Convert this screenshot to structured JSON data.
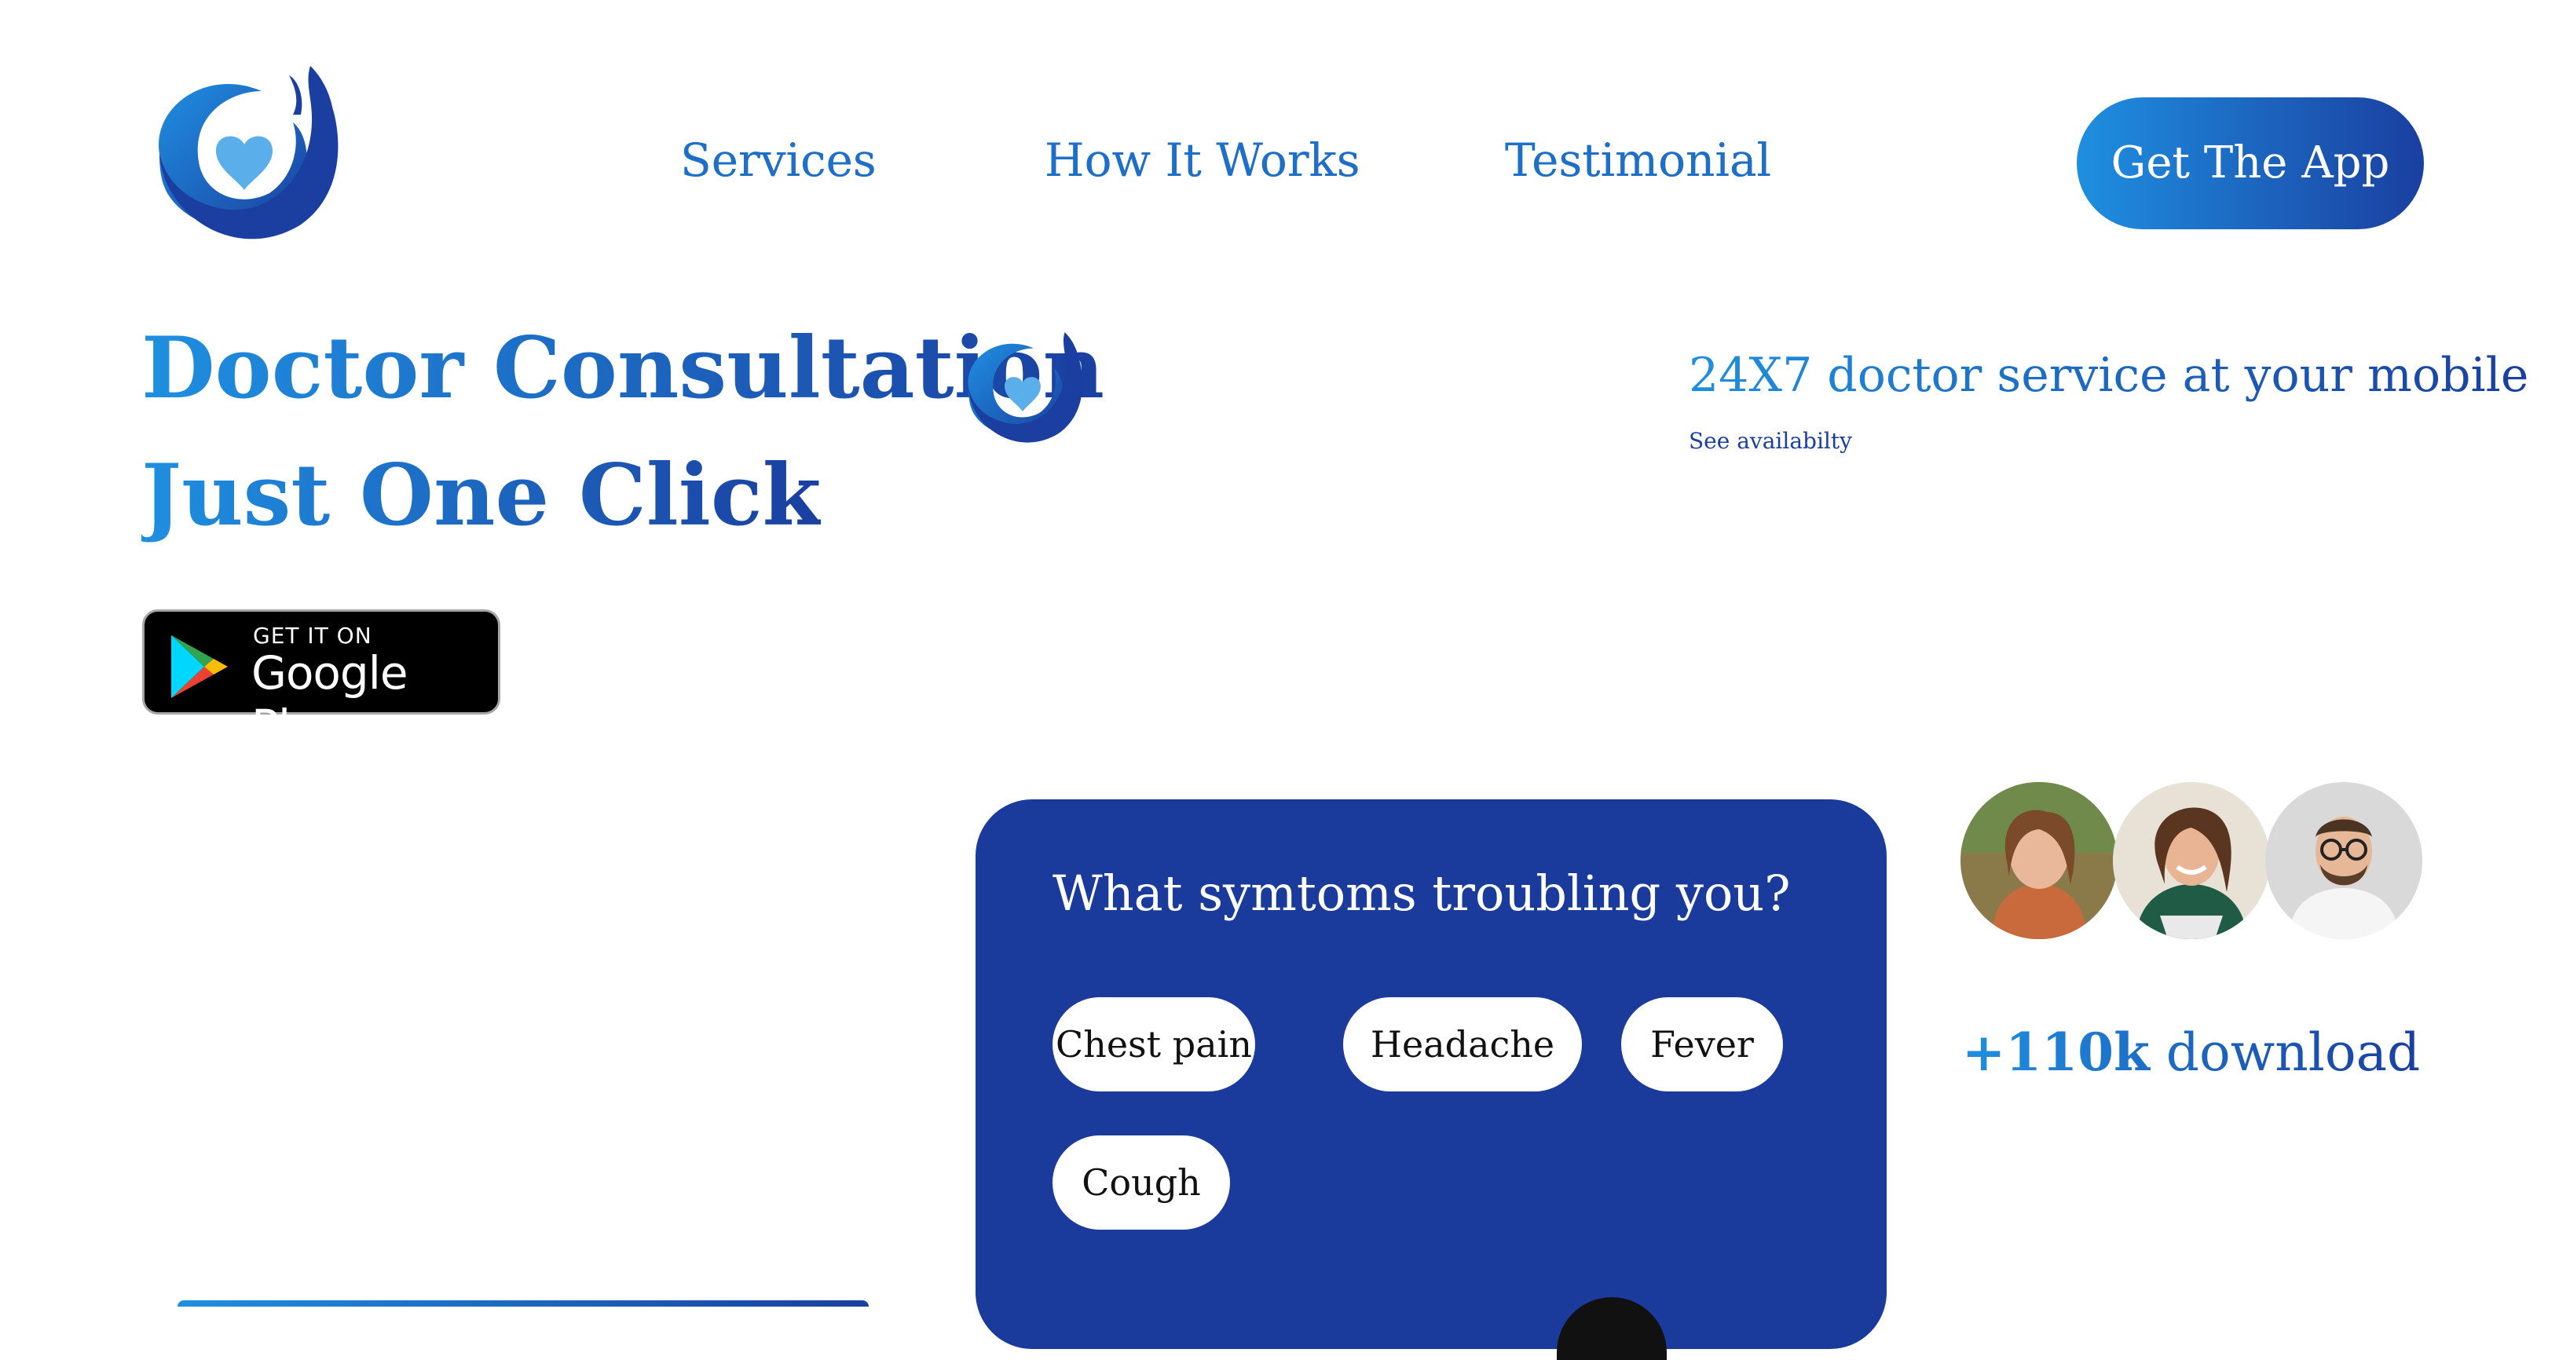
{
  "nav": {
    "items": [
      {
        "label": "Services"
      },
      {
        "label": "How It Works"
      },
      {
        "label": "Testimonial"
      }
    ],
    "cta_label": "Get The App"
  },
  "hero": {
    "title_line_1": "Doctor Consultation",
    "title_line_2": "Just One Click",
    "tagline": "24X7 doctor service at your mobile",
    "see_link": "See availabilty"
  },
  "store_badge": {
    "small_text": "GET IT ON",
    "big_text": "Google Play"
  },
  "symptoms": {
    "title": "What symtoms troubling you?",
    "chips": [
      "Chest pain",
      "Headache",
      "Fever",
      "Cough"
    ]
  },
  "downloads": {
    "count": "+110k",
    "label": "download"
  },
  "icons": {
    "logo": "heart-hand-logo-icon",
    "store": "google-play-icon"
  },
  "colors": {
    "brand_light": "#1f8fe0",
    "brand_dark": "#1a3fa0",
    "card_bg": "#1a3b9c",
    "heart": "#5aaeea"
  }
}
